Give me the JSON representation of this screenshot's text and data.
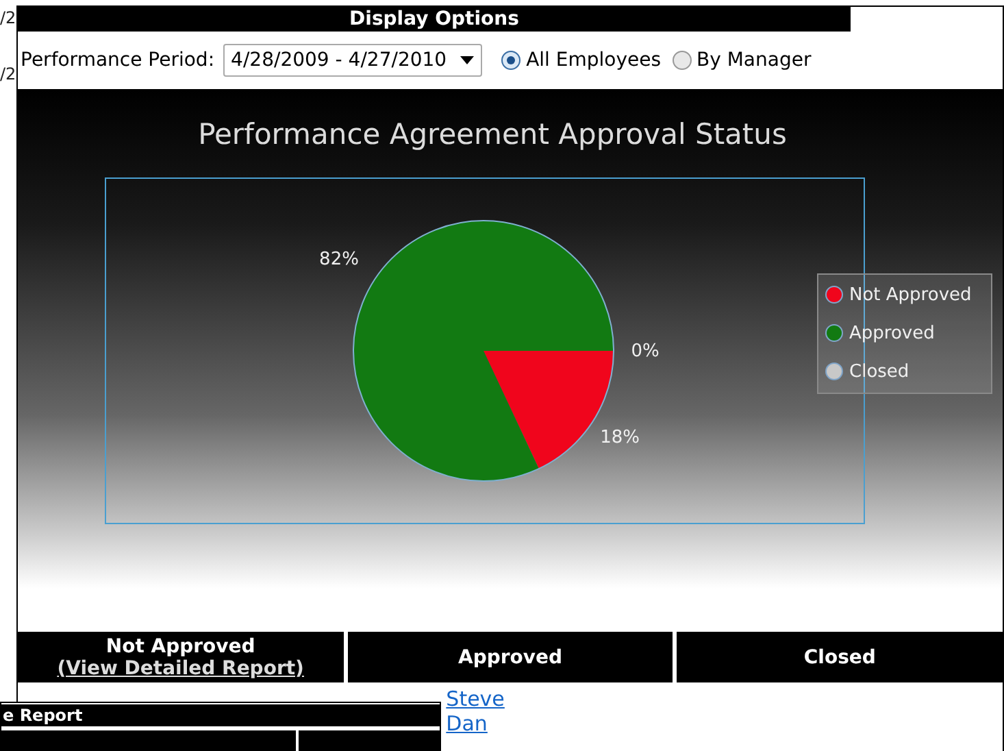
{
  "background_page": {
    "texts": [
      "/2",
      "/2"
    ]
  },
  "dialog": {
    "title": "Display Options",
    "filter": {
      "label": "Performance Period:",
      "period": "4/28/2009 - 4/27/2010",
      "options": [
        {
          "label": "All Employees",
          "selected": true
        },
        {
          "label": "By Manager",
          "selected": false
        }
      ]
    },
    "chart": {
      "chart_data": {
        "type": "pie",
        "title": "Performance Agreement Approval Status",
        "categories": [
          "Not Approved",
          "Approved",
          "Closed"
        ],
        "values": [
          18,
          82,
          0
        ],
        "colors": [
          "#f0051c",
          "#127a12",
          "#c8c8c8"
        ],
        "legend": "right",
        "value_labels": [
          "18%",
          "82%",
          "0%"
        ]
      }
    },
    "table": {
      "columns": [
        {
          "title": "Not Approved",
          "link": "(View Detailed Report)"
        },
        {
          "title": "Approved",
          "items": [
            "Steve",
            "Dan"
          ]
        },
        {
          "title": "Closed"
        }
      ]
    }
  },
  "overlay_window": {
    "title": "e Report"
  }
}
